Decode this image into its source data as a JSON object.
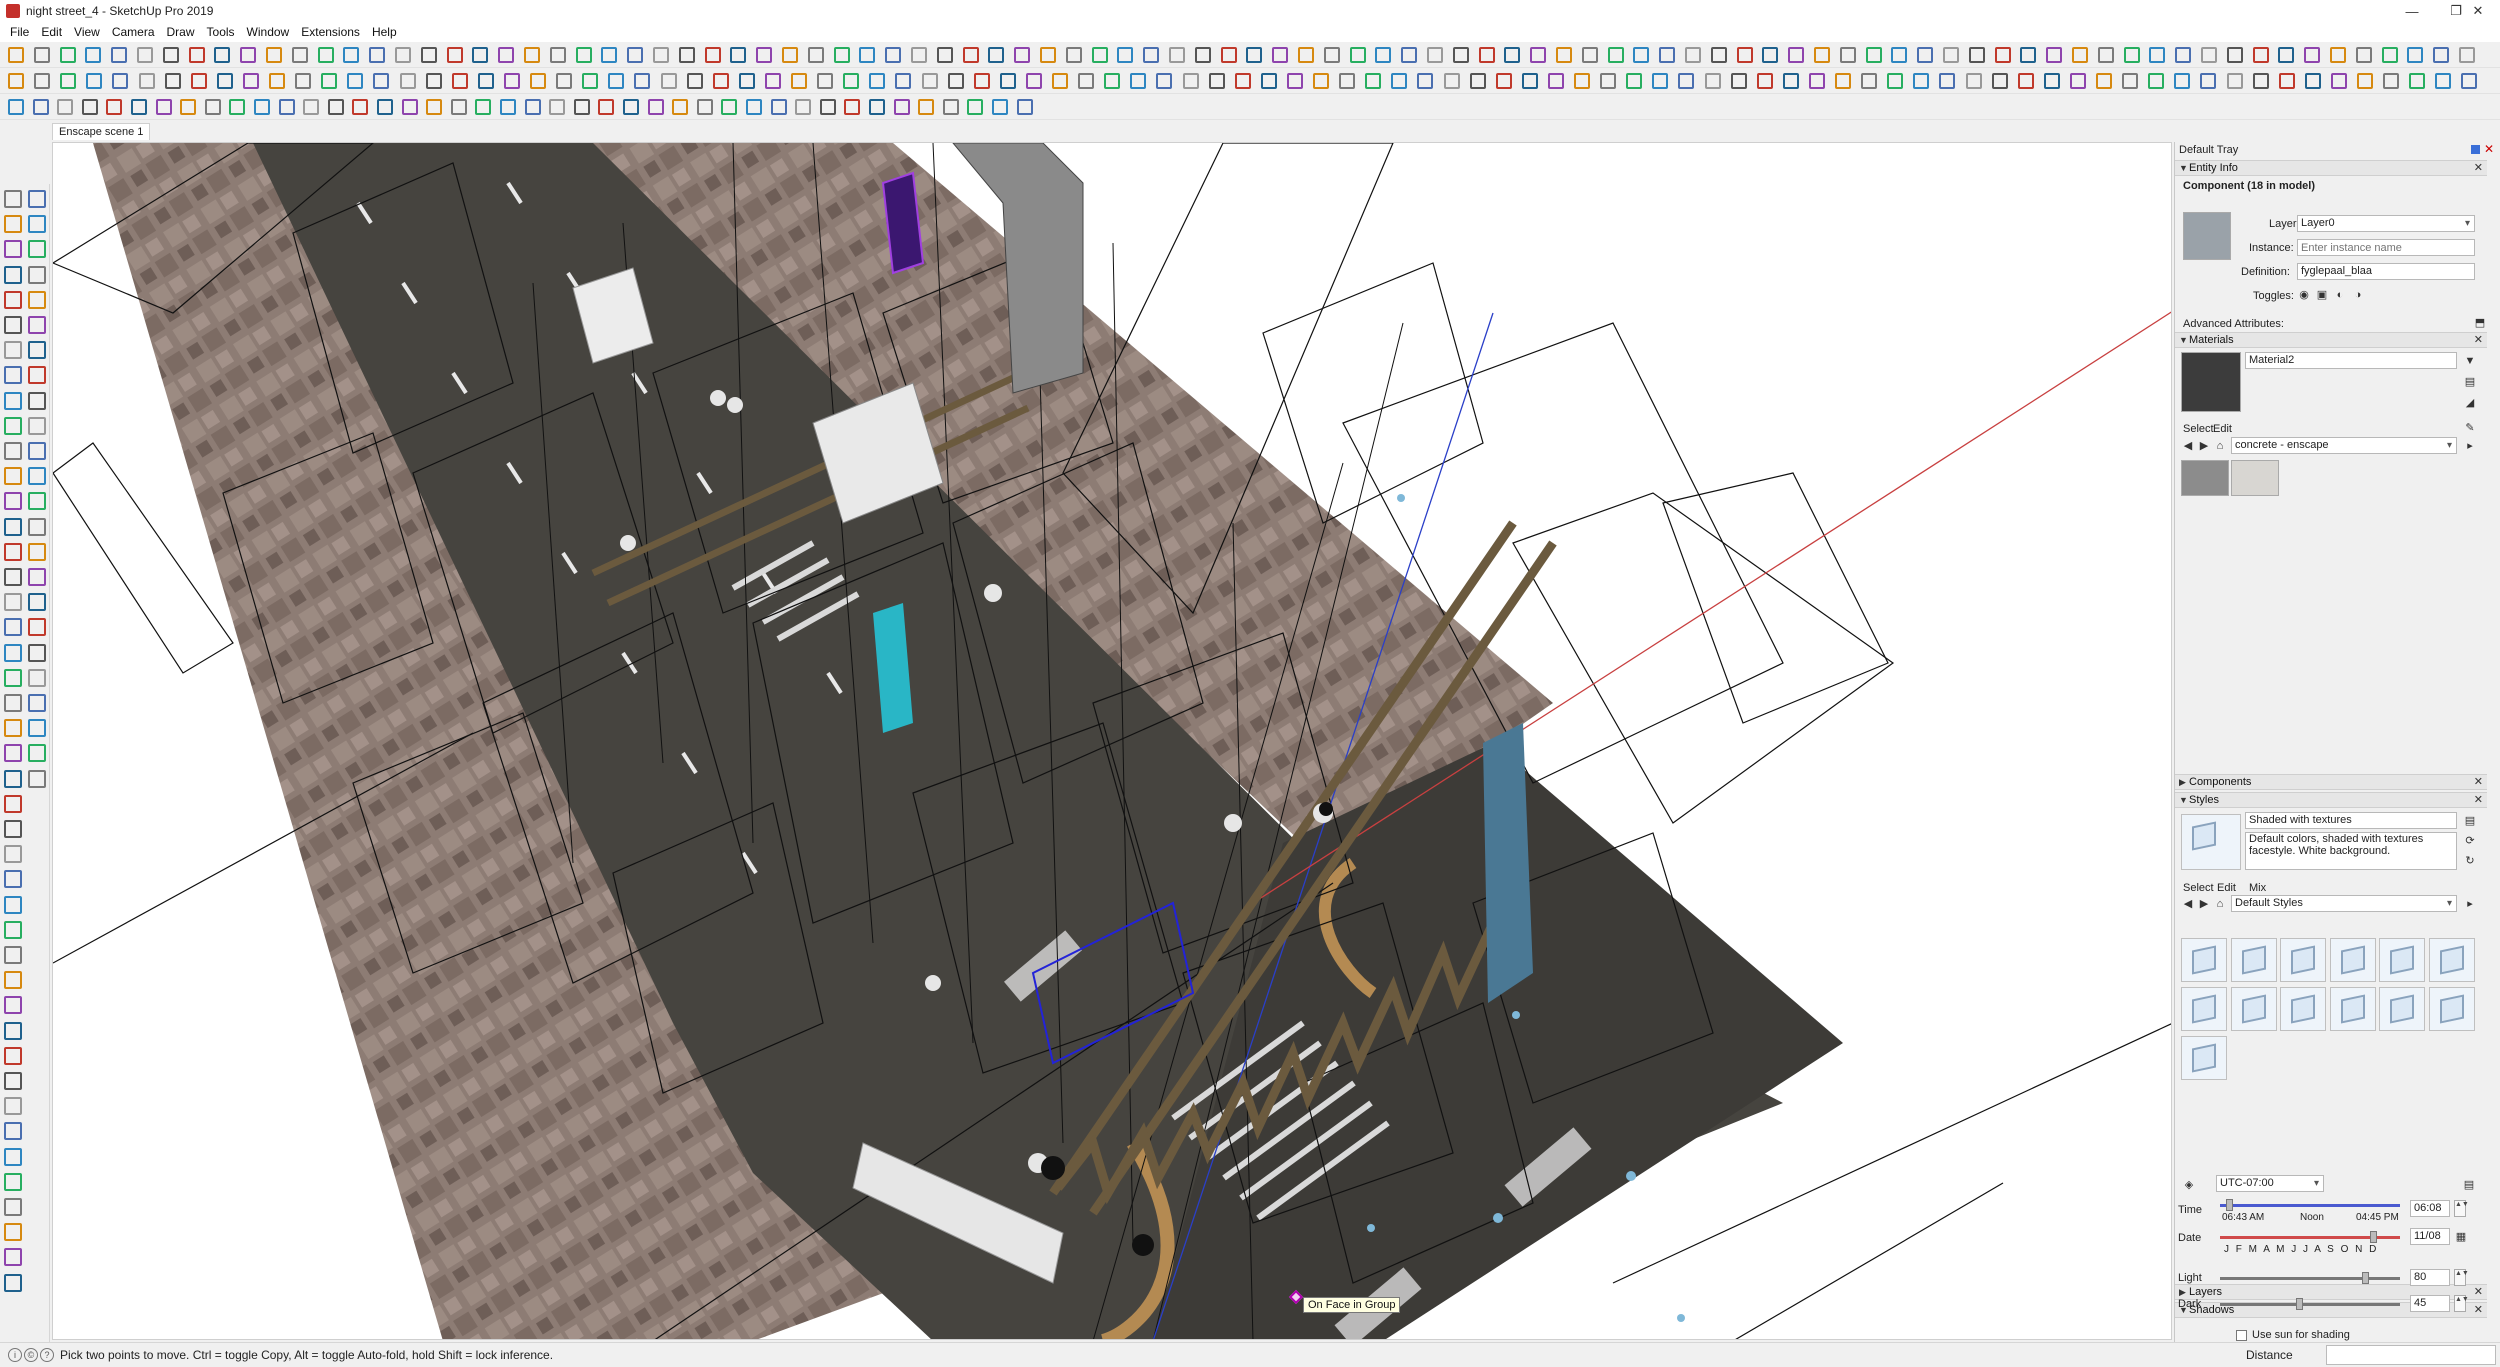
{
  "window": {
    "title": "night street_4 - SketchUp Pro 2019",
    "controls": [
      "—",
      "❐",
      "✕"
    ]
  },
  "menu": [
    "File",
    "Edit",
    "View",
    "Camera",
    "Draw",
    "Tools",
    "Window",
    "Extensions",
    "Help"
  ],
  "scene_tab": "Enscape scene 1",
  "viewport": {
    "tooltip": "On Face in Group"
  },
  "status": {
    "hint": "Pick two points to move.  Ctrl = toggle Copy, Alt = toggle Auto-fold, hold Shift = lock inference.",
    "measurement_label": "Distance",
    "icons": [
      "geo-location-icon",
      "credits-icon",
      "help-icon"
    ]
  },
  "tray": {
    "title": "Default Tray",
    "entity_info": {
      "header": "Entity Info",
      "summary": "Component (18 in model)",
      "layer_label": "Layer:",
      "layer_value": "Layer0",
      "instance_label": "Instance:",
      "instance_placeholder": "Enter instance name",
      "definition_label": "Definition:",
      "definition_value": "fyglepaal_blaa",
      "toggles_label": "Toggles:",
      "advanced_label": "Advanced Attributes:"
    },
    "materials": {
      "header": "Materials",
      "name": "Material2",
      "tab_select": "Select",
      "tab_edit": "Edit",
      "library": "concrete - enscape"
    },
    "components": {
      "header": "Components"
    },
    "styles": {
      "header": "Styles",
      "name": "Shaded with textures",
      "description": "Default colors, shaded with textures facestyle. White background.",
      "tab_select": "Select",
      "tab_edit": "Edit",
      "tab_mix": "Mix",
      "library": "Default Styles"
    },
    "layers": {
      "header": "Layers"
    },
    "shadows": {
      "header": "Shadows",
      "timezone": "UTC-07:00",
      "time_label": "Time",
      "time_start": "06:43 AM",
      "time_noon": "Noon",
      "time_end": "04:45 PM",
      "time_value": "06:08",
      "date_label": "Date",
      "months": "J F M A M J J A S O N D",
      "date_value": "11/08",
      "light_label": "Light",
      "light_value": "80",
      "dark_label": "Dark",
      "dark_value": "45",
      "use_sun_label": "Use sun for shading"
    }
  }
}
